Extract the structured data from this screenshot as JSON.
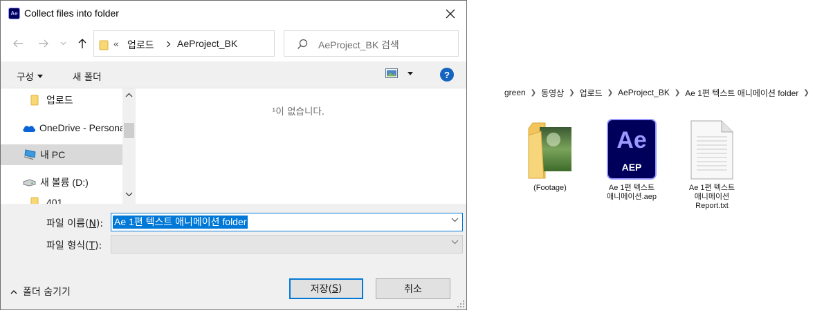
{
  "dialog": {
    "app_icon_text": "Ae",
    "title": "Collect files into folder",
    "address": {
      "overflow": "«",
      "crumbs": [
        "업로드",
        "AeProject_BK"
      ]
    },
    "search_placeholder": "AeProject_BK 검색",
    "toolbar": {
      "organize": "구성",
      "new_folder": "새 폴더"
    },
    "nav_items": [
      {
        "label": "업로드",
        "icon": "folder-icon"
      },
      {
        "label": "OneDrive - Personal",
        "icon": "onedrive-icon"
      },
      {
        "label": "내 PC",
        "icon": "pc-icon"
      },
      {
        "label": "새 볼륨 (D:)",
        "icon": "drive-icon"
      },
      {
        "label": "401",
        "icon": "folder-icon"
      }
    ],
    "empty_message": "¹이 없습니다.",
    "filename_label": "파일 이름(",
    "filename_key": "N",
    "filename_label_end": "):",
    "filename_value": "Ae 1편 텍스트 애니메이션 folder",
    "filetype_label": "파일 형식(",
    "filetype_key": "T",
    "filetype_label_end": "):",
    "filetype_value": "",
    "hide_folders": "폴더 숨기기",
    "save_label": "저장(",
    "save_key": "S",
    "save_label_end": ")",
    "cancel_label": "취소"
  },
  "explorer": {
    "breadcrumb": [
      "green",
      "동영상",
      "업로드",
      "AeProject_BK",
      "Ae 1편 텍스트 애니메이션 folder"
    ],
    "items": [
      {
        "name": "(Footage)",
        "icon": "folder-footage-icon"
      },
      {
        "name_line1": "Ae 1편 텍스트",
        "name_line2": "애니메이션.aep",
        "icon_text_top": "Ae",
        "icon_text_bottom": "AEP"
      },
      {
        "name_line1": "Ae 1편 텍스트",
        "name_line2": "애니메이션",
        "name_line3": "Report.txt",
        "icon": "text-file-icon"
      }
    ]
  },
  "colors": {
    "accent": "#0078d7",
    "ae_bg": "#00005b",
    "ae_text": "#9999ff",
    "help": "#1565c0"
  }
}
